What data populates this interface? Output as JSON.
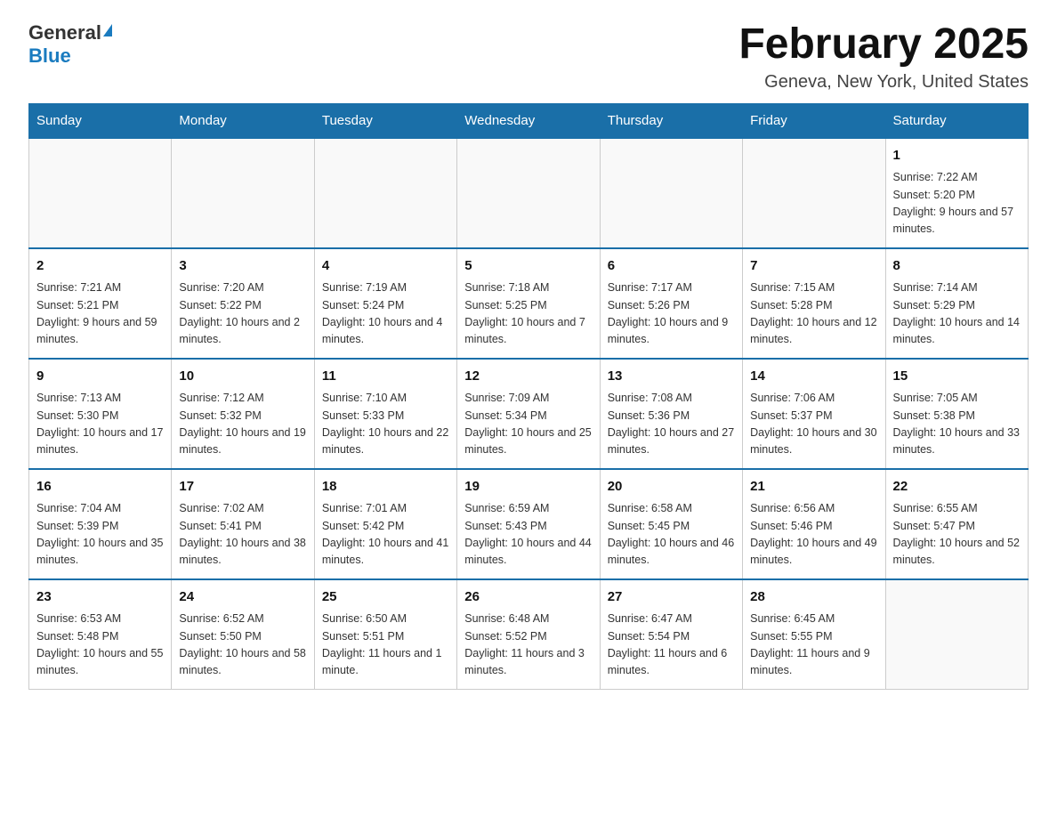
{
  "header": {
    "logo_general": "General",
    "logo_blue": "Blue",
    "month_title": "February 2025",
    "location": "Geneva, New York, United States"
  },
  "days_of_week": [
    "Sunday",
    "Monday",
    "Tuesday",
    "Wednesday",
    "Thursday",
    "Friday",
    "Saturday"
  ],
  "weeks": [
    [
      {
        "day": "",
        "info": ""
      },
      {
        "day": "",
        "info": ""
      },
      {
        "day": "",
        "info": ""
      },
      {
        "day": "",
        "info": ""
      },
      {
        "day": "",
        "info": ""
      },
      {
        "day": "",
        "info": ""
      },
      {
        "day": "1",
        "info": "Sunrise: 7:22 AM\nSunset: 5:20 PM\nDaylight: 9 hours and 57 minutes."
      }
    ],
    [
      {
        "day": "2",
        "info": "Sunrise: 7:21 AM\nSunset: 5:21 PM\nDaylight: 9 hours and 59 minutes."
      },
      {
        "day": "3",
        "info": "Sunrise: 7:20 AM\nSunset: 5:22 PM\nDaylight: 10 hours and 2 minutes."
      },
      {
        "day": "4",
        "info": "Sunrise: 7:19 AM\nSunset: 5:24 PM\nDaylight: 10 hours and 4 minutes."
      },
      {
        "day": "5",
        "info": "Sunrise: 7:18 AM\nSunset: 5:25 PM\nDaylight: 10 hours and 7 minutes."
      },
      {
        "day": "6",
        "info": "Sunrise: 7:17 AM\nSunset: 5:26 PM\nDaylight: 10 hours and 9 minutes."
      },
      {
        "day": "7",
        "info": "Sunrise: 7:15 AM\nSunset: 5:28 PM\nDaylight: 10 hours and 12 minutes."
      },
      {
        "day": "8",
        "info": "Sunrise: 7:14 AM\nSunset: 5:29 PM\nDaylight: 10 hours and 14 minutes."
      }
    ],
    [
      {
        "day": "9",
        "info": "Sunrise: 7:13 AM\nSunset: 5:30 PM\nDaylight: 10 hours and 17 minutes."
      },
      {
        "day": "10",
        "info": "Sunrise: 7:12 AM\nSunset: 5:32 PM\nDaylight: 10 hours and 19 minutes."
      },
      {
        "day": "11",
        "info": "Sunrise: 7:10 AM\nSunset: 5:33 PM\nDaylight: 10 hours and 22 minutes."
      },
      {
        "day": "12",
        "info": "Sunrise: 7:09 AM\nSunset: 5:34 PM\nDaylight: 10 hours and 25 minutes."
      },
      {
        "day": "13",
        "info": "Sunrise: 7:08 AM\nSunset: 5:36 PM\nDaylight: 10 hours and 27 minutes."
      },
      {
        "day": "14",
        "info": "Sunrise: 7:06 AM\nSunset: 5:37 PM\nDaylight: 10 hours and 30 minutes."
      },
      {
        "day": "15",
        "info": "Sunrise: 7:05 AM\nSunset: 5:38 PM\nDaylight: 10 hours and 33 minutes."
      }
    ],
    [
      {
        "day": "16",
        "info": "Sunrise: 7:04 AM\nSunset: 5:39 PM\nDaylight: 10 hours and 35 minutes."
      },
      {
        "day": "17",
        "info": "Sunrise: 7:02 AM\nSunset: 5:41 PM\nDaylight: 10 hours and 38 minutes."
      },
      {
        "day": "18",
        "info": "Sunrise: 7:01 AM\nSunset: 5:42 PM\nDaylight: 10 hours and 41 minutes."
      },
      {
        "day": "19",
        "info": "Sunrise: 6:59 AM\nSunset: 5:43 PM\nDaylight: 10 hours and 44 minutes."
      },
      {
        "day": "20",
        "info": "Sunrise: 6:58 AM\nSunset: 5:45 PM\nDaylight: 10 hours and 46 minutes."
      },
      {
        "day": "21",
        "info": "Sunrise: 6:56 AM\nSunset: 5:46 PM\nDaylight: 10 hours and 49 minutes."
      },
      {
        "day": "22",
        "info": "Sunrise: 6:55 AM\nSunset: 5:47 PM\nDaylight: 10 hours and 52 minutes."
      }
    ],
    [
      {
        "day": "23",
        "info": "Sunrise: 6:53 AM\nSunset: 5:48 PM\nDaylight: 10 hours and 55 minutes."
      },
      {
        "day": "24",
        "info": "Sunrise: 6:52 AM\nSunset: 5:50 PM\nDaylight: 10 hours and 58 minutes."
      },
      {
        "day": "25",
        "info": "Sunrise: 6:50 AM\nSunset: 5:51 PM\nDaylight: 11 hours and 1 minute."
      },
      {
        "day": "26",
        "info": "Sunrise: 6:48 AM\nSunset: 5:52 PM\nDaylight: 11 hours and 3 minutes."
      },
      {
        "day": "27",
        "info": "Sunrise: 6:47 AM\nSunset: 5:54 PM\nDaylight: 11 hours and 6 minutes."
      },
      {
        "day": "28",
        "info": "Sunrise: 6:45 AM\nSunset: 5:55 PM\nDaylight: 11 hours and 9 minutes."
      },
      {
        "day": "",
        "info": ""
      }
    ]
  ]
}
